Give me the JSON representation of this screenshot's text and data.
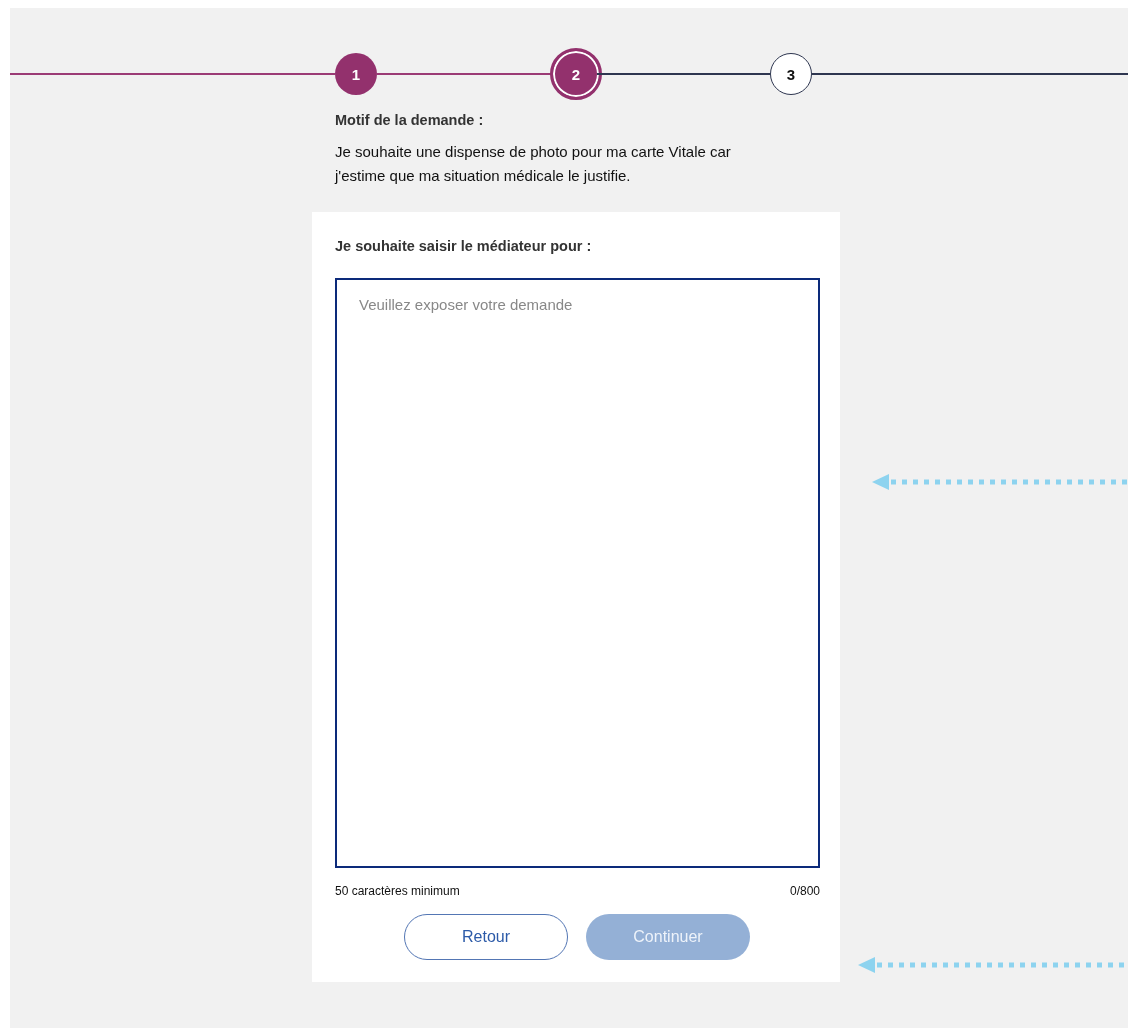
{
  "stepper": {
    "steps": [
      {
        "number": "1",
        "completed": true,
        "selected": false
      },
      {
        "number": "2",
        "completed": false,
        "selected": true
      },
      {
        "number": "3",
        "completed": false,
        "selected": false
      }
    ]
  },
  "reason": {
    "label": "Motif de la demande :",
    "text": "Je souhaite une dispense de photo pour ma carte Vitale car j'estime que ma situation médicale le justifie."
  },
  "form": {
    "label": "Je souhaite saisir le médiateur pour :",
    "field": {
      "placeholder": "Veuillez exposer votre demande"
    },
    "hint": "50 caractères minimum",
    "counter": "0/800",
    "buttons": [
      {
        "label": "Retour",
        "kind": "secondary",
        "disabled": false
      },
      {
        "label": "Continuer",
        "kind": "primary",
        "disabled": true
      }
    ]
  }
}
